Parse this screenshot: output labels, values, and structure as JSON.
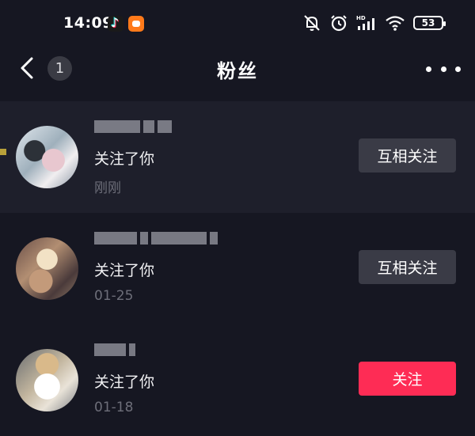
{
  "status_bar": {
    "time": "14:09",
    "battery": "53",
    "icons": [
      "tiktok-icon",
      "app-icon",
      "mute-icon",
      "alarm-icon",
      "signal-icon",
      "wifi-icon",
      "battery-icon"
    ]
  },
  "nav": {
    "badge": "1",
    "title": "粉丝",
    "icons": [
      "back-icon",
      "more-icon"
    ]
  },
  "followers": [
    {
      "action": "关注了你",
      "time": "刚刚",
      "button": "互相关注",
      "button_type": "mutual",
      "highlighted": true
    },
    {
      "action": "关注了你",
      "time": "01-25",
      "button": "互相关注",
      "button_type": "mutual",
      "highlighted": false
    },
    {
      "action": "关注了你",
      "time": "01-18",
      "button": "关注",
      "button_type": "follow",
      "highlighted": false
    }
  ],
  "colors": {
    "background": "#161722",
    "highlight_row": "#1e1f2b",
    "mutual_button": "#3a3b46",
    "follow_button": "#fe2c55",
    "secondary_text": "#6d6e79"
  }
}
